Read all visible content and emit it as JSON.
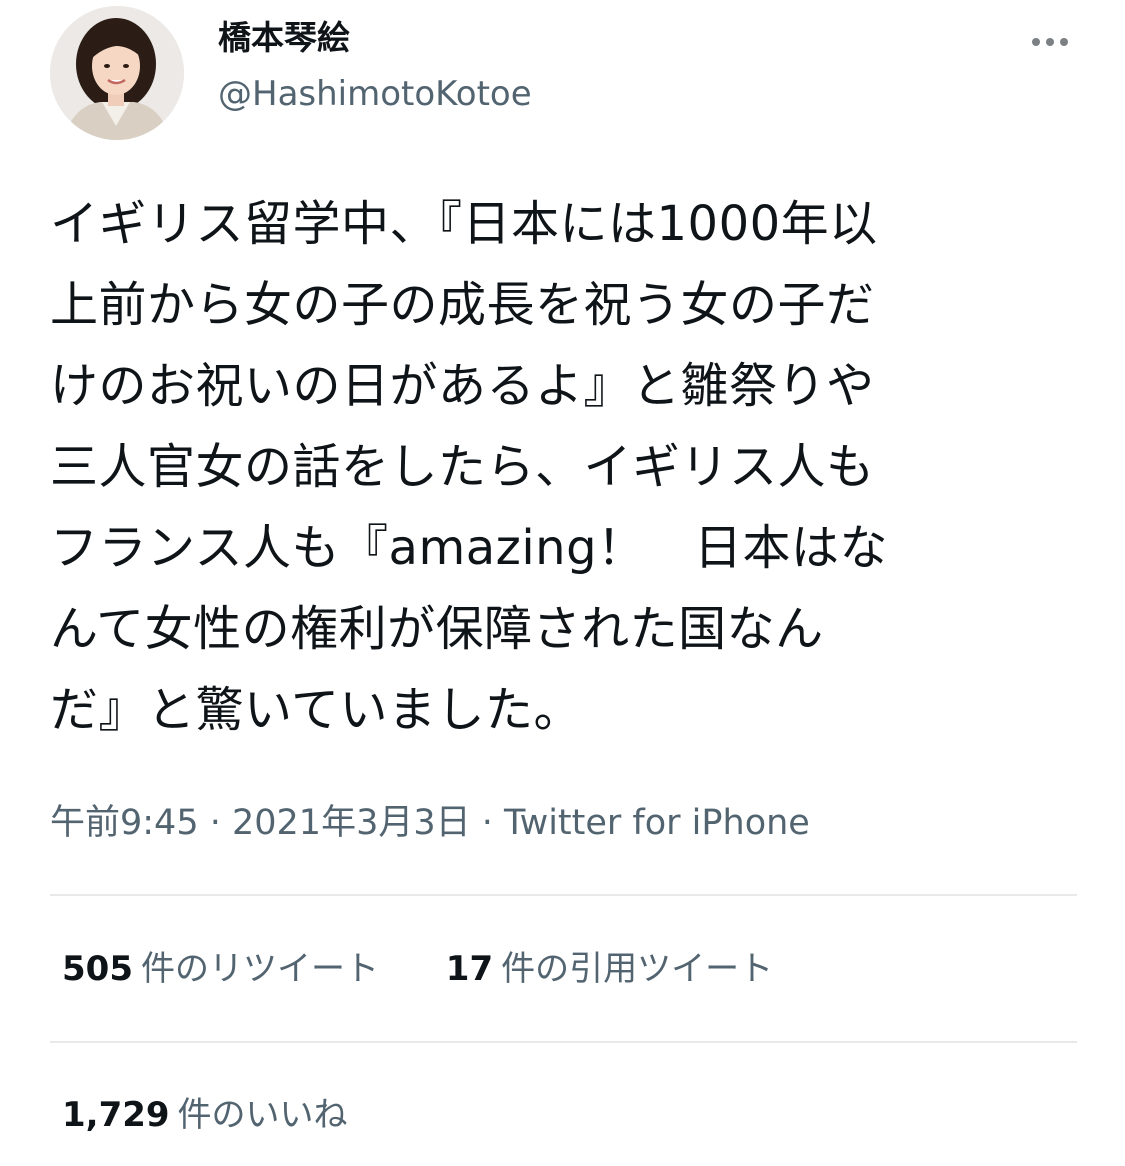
{
  "user": {
    "display_name": "橋本琴絵",
    "handle": "@HashimotoKotoe"
  },
  "tweet": {
    "lines": [
      "イギリス留学中、『日本には1000年以",
      "上前から女の子の成長を祝う女の子だ",
      "けのお祝いの日があるよ』と雛祭りや",
      "三人官女の話をしたら、イギリス人も",
      "フランス人も『amazing！　日本はな",
      "んて女性の権利が保障された国なん",
      "だ』と驚いていました。"
    ]
  },
  "meta": {
    "time": "午前9:45",
    "sep1": " · ",
    "date": "2021年3月3日",
    "sep2": " · ",
    "source": "Twitter for iPhone"
  },
  "stats": {
    "retweets": {
      "count": "505",
      "label": "件のリツイート"
    },
    "quotes": {
      "count": "17",
      "label": "件の引用ツイート"
    },
    "likes": {
      "count": "1,729",
      "label": "件のいいね"
    }
  },
  "icons": {
    "more": "more-dots-icon"
  }
}
